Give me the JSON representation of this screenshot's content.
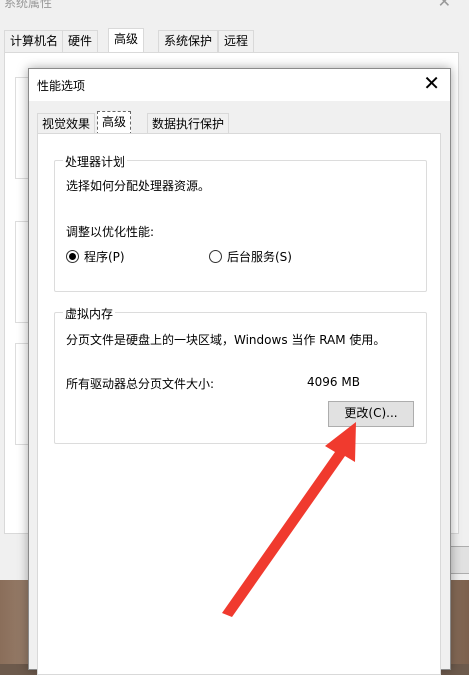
{
  "outer_window": {
    "title": "系统属性",
    "tabs": [
      {
        "label": "计算机名",
        "active": false
      },
      {
        "label": "硬件",
        "active": false
      },
      {
        "label": "高级",
        "active": true
      },
      {
        "label": "系统保护",
        "active": false
      },
      {
        "label": "远程",
        "active": false
      }
    ]
  },
  "dialog": {
    "title": "性能选项",
    "close_glyph": "✕",
    "tabs": [
      {
        "label": "视觉效果",
        "active": false
      },
      {
        "label": "高级",
        "active": true
      },
      {
        "label": "数据执行保护",
        "active": false
      }
    ],
    "processor_group": {
      "label": "处理器计划",
      "description": "选择如何分配处理器资源。",
      "adjust_label": "调整以优化性能:",
      "options": [
        {
          "label": "程序(P)",
          "checked": true
        },
        {
          "label": "后台服务(S)",
          "checked": false
        }
      ]
    },
    "virtual_memory_group": {
      "label": "虚拟内存",
      "description": "分页文件是硬盘上的一块区域，Windows 当作 RAM 使用。",
      "total_label": "所有驱动器总分页文件大小:",
      "total_value": "4096 MB",
      "change_button": "更改(C)..."
    }
  },
  "colors": {
    "arrow": "#f03a2e"
  }
}
